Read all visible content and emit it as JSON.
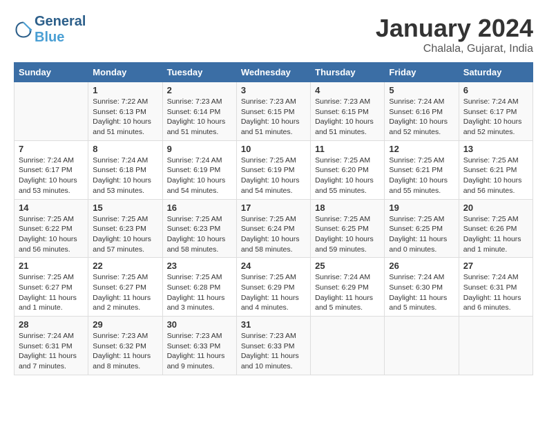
{
  "header": {
    "logo_line1": "General",
    "logo_line2": "Blue",
    "month_title": "January 2024",
    "location": "Chalala, Gujarat, India"
  },
  "weekdays": [
    "Sunday",
    "Monday",
    "Tuesday",
    "Wednesday",
    "Thursday",
    "Friday",
    "Saturday"
  ],
  "weeks": [
    [
      {
        "day": "",
        "info": ""
      },
      {
        "day": "1",
        "info": "Sunrise: 7:22 AM\nSunset: 6:13 PM\nDaylight: 10 hours\nand 51 minutes."
      },
      {
        "day": "2",
        "info": "Sunrise: 7:23 AM\nSunset: 6:14 PM\nDaylight: 10 hours\nand 51 minutes."
      },
      {
        "day": "3",
        "info": "Sunrise: 7:23 AM\nSunset: 6:15 PM\nDaylight: 10 hours\nand 51 minutes."
      },
      {
        "day": "4",
        "info": "Sunrise: 7:23 AM\nSunset: 6:15 PM\nDaylight: 10 hours\nand 51 minutes."
      },
      {
        "day": "5",
        "info": "Sunrise: 7:24 AM\nSunset: 6:16 PM\nDaylight: 10 hours\nand 52 minutes."
      },
      {
        "day": "6",
        "info": "Sunrise: 7:24 AM\nSunset: 6:17 PM\nDaylight: 10 hours\nand 52 minutes."
      }
    ],
    [
      {
        "day": "7",
        "info": "Sunrise: 7:24 AM\nSunset: 6:17 PM\nDaylight: 10 hours\nand 53 minutes."
      },
      {
        "day": "8",
        "info": "Sunrise: 7:24 AM\nSunset: 6:18 PM\nDaylight: 10 hours\nand 53 minutes."
      },
      {
        "day": "9",
        "info": "Sunrise: 7:24 AM\nSunset: 6:19 PM\nDaylight: 10 hours\nand 54 minutes."
      },
      {
        "day": "10",
        "info": "Sunrise: 7:25 AM\nSunset: 6:19 PM\nDaylight: 10 hours\nand 54 minutes."
      },
      {
        "day": "11",
        "info": "Sunrise: 7:25 AM\nSunset: 6:20 PM\nDaylight: 10 hours\nand 55 minutes."
      },
      {
        "day": "12",
        "info": "Sunrise: 7:25 AM\nSunset: 6:21 PM\nDaylight: 10 hours\nand 55 minutes."
      },
      {
        "day": "13",
        "info": "Sunrise: 7:25 AM\nSunset: 6:21 PM\nDaylight: 10 hours\nand 56 minutes."
      }
    ],
    [
      {
        "day": "14",
        "info": "Sunrise: 7:25 AM\nSunset: 6:22 PM\nDaylight: 10 hours\nand 56 minutes."
      },
      {
        "day": "15",
        "info": "Sunrise: 7:25 AM\nSunset: 6:23 PM\nDaylight: 10 hours\nand 57 minutes."
      },
      {
        "day": "16",
        "info": "Sunrise: 7:25 AM\nSunset: 6:23 PM\nDaylight: 10 hours\nand 58 minutes."
      },
      {
        "day": "17",
        "info": "Sunrise: 7:25 AM\nSunset: 6:24 PM\nDaylight: 10 hours\nand 58 minutes."
      },
      {
        "day": "18",
        "info": "Sunrise: 7:25 AM\nSunset: 6:25 PM\nDaylight: 10 hours\nand 59 minutes."
      },
      {
        "day": "19",
        "info": "Sunrise: 7:25 AM\nSunset: 6:25 PM\nDaylight: 11 hours\nand 0 minutes."
      },
      {
        "day": "20",
        "info": "Sunrise: 7:25 AM\nSunset: 6:26 PM\nDaylight: 11 hours\nand 1 minute."
      }
    ],
    [
      {
        "day": "21",
        "info": "Sunrise: 7:25 AM\nSunset: 6:27 PM\nDaylight: 11 hours\nand 1 minute."
      },
      {
        "day": "22",
        "info": "Sunrise: 7:25 AM\nSunset: 6:27 PM\nDaylight: 11 hours\nand 2 minutes."
      },
      {
        "day": "23",
        "info": "Sunrise: 7:25 AM\nSunset: 6:28 PM\nDaylight: 11 hours\nand 3 minutes."
      },
      {
        "day": "24",
        "info": "Sunrise: 7:25 AM\nSunset: 6:29 PM\nDaylight: 11 hours\nand 4 minutes."
      },
      {
        "day": "25",
        "info": "Sunrise: 7:24 AM\nSunset: 6:29 PM\nDaylight: 11 hours\nand 5 minutes."
      },
      {
        "day": "26",
        "info": "Sunrise: 7:24 AM\nSunset: 6:30 PM\nDaylight: 11 hours\nand 5 minutes."
      },
      {
        "day": "27",
        "info": "Sunrise: 7:24 AM\nSunset: 6:31 PM\nDaylight: 11 hours\nand 6 minutes."
      }
    ],
    [
      {
        "day": "28",
        "info": "Sunrise: 7:24 AM\nSunset: 6:31 PM\nDaylight: 11 hours\nand 7 minutes."
      },
      {
        "day": "29",
        "info": "Sunrise: 7:23 AM\nSunset: 6:32 PM\nDaylight: 11 hours\nand 8 minutes."
      },
      {
        "day": "30",
        "info": "Sunrise: 7:23 AM\nSunset: 6:33 PM\nDaylight: 11 hours\nand 9 minutes."
      },
      {
        "day": "31",
        "info": "Sunrise: 7:23 AM\nSunset: 6:33 PM\nDaylight: 11 hours\nand 10 minutes."
      },
      {
        "day": "",
        "info": ""
      },
      {
        "day": "",
        "info": ""
      },
      {
        "day": "",
        "info": ""
      }
    ]
  ]
}
